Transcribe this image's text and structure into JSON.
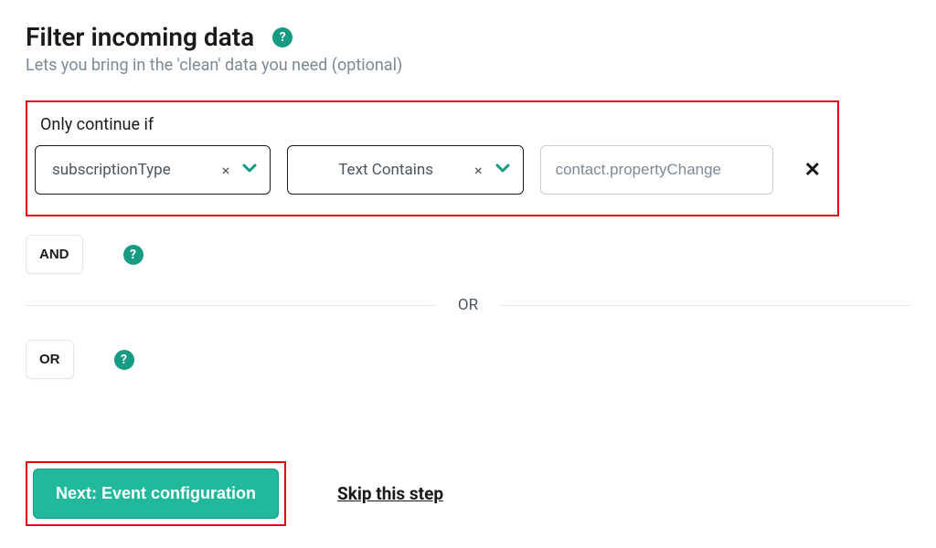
{
  "header": {
    "title": "Filter incoming data",
    "subtitle": "Lets you bring in the 'clean' data you need (optional)",
    "help": "?"
  },
  "filter": {
    "label": "Only continue if",
    "field": {
      "value": "subscriptionType",
      "clear": "×"
    },
    "operator": {
      "value": "Text Contains",
      "clear": "×"
    },
    "value_input": "contact.propertyChange",
    "remove": "✕"
  },
  "logic": {
    "and": "AND",
    "or": "OR",
    "help": "?",
    "divider": "OR"
  },
  "footer": {
    "next": "Next: Event configuration",
    "skip": "Skip this step"
  }
}
